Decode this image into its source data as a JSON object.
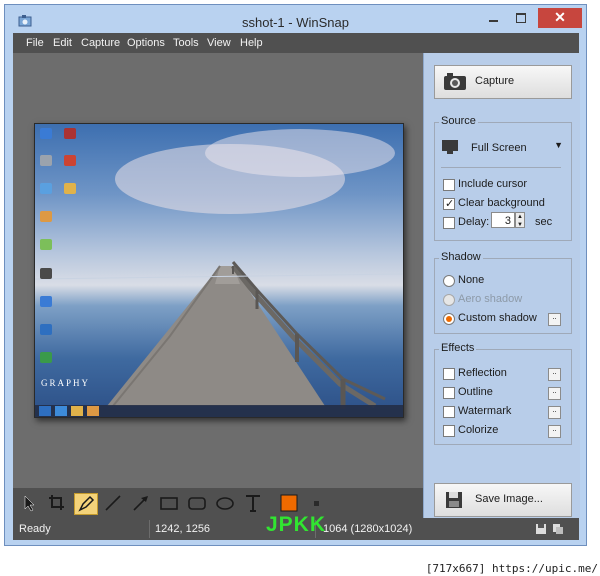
{
  "window": {
    "title": "sshot-1 - WinSnap",
    "close_label": "✕"
  },
  "menu": [
    "File",
    "Edit",
    "Capture",
    "Options",
    "Tools",
    "View",
    "Help"
  ],
  "panel": {
    "capture_label": "Capture",
    "source": {
      "title": "Source",
      "mode": "Full Screen",
      "include_cursor": "Include cursor",
      "clear_background": "Clear background",
      "delay_label": "Delay:",
      "delay_value": "3",
      "delay_unit": "sec"
    },
    "shadow": {
      "title": "Shadow",
      "none": "None",
      "aero": "Aero shadow",
      "custom": "Custom shadow"
    },
    "effects": {
      "title": "Effects",
      "reflection": "Reflection",
      "outline": "Outline",
      "watermark": "Watermark",
      "colorize": "Colorize"
    },
    "save_label": "Save Image..."
  },
  "status": {
    "state": "Ready",
    "coords": "1242, 1256",
    "size": "1064 (1280x1024)"
  },
  "screenshot": {
    "watermark_text": "GRAPHY"
  },
  "overlay": {
    "jpkk": "JPKK",
    "upic": "[717x667] https://upic.me/"
  },
  "colors": {
    "accent": "#ef6a00",
    "panel_bg": "#b8cde9",
    "menubar_bg": "#505050",
    "close_red": "#c7463e"
  }
}
